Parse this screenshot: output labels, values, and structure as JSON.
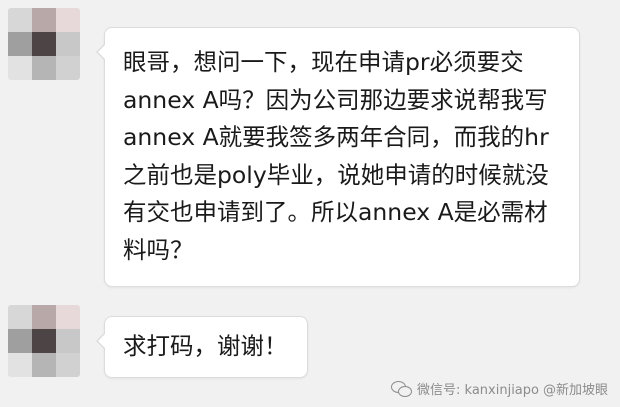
{
  "messages": [
    {
      "lines": [
        "眼哥，想问一下，现在申请pr必须要交",
        "annex A吗？因为公司那边要求说帮我写",
        "annex A就要我签多两年合同，而我的hr",
        "之前也是poly毕业，说她申请的时候就没",
        "有交也申请到了。所以annex A是必需材",
        "料吗？"
      ]
    },
    {
      "lines": [
        "求打码，谢谢！"
      ]
    }
  ],
  "watermark": {
    "text": "微信号: kanxinjiapo",
    "handle": "@新加坡眼",
    "icon": "wechat-icon"
  },
  "avatar_colors": [
    "#d7d7d7",
    "#b9a8a8",
    "#e7d9d9",
    "#9f9f9f",
    "#4d4545",
    "#c8c8c8",
    "#e2e2e2",
    "#b5b5b5",
    "#d1d1d1"
  ],
  "colors": {
    "background": "#f1f1f1",
    "bubble": "#ffffff",
    "text": "#1a1a1a"
  }
}
